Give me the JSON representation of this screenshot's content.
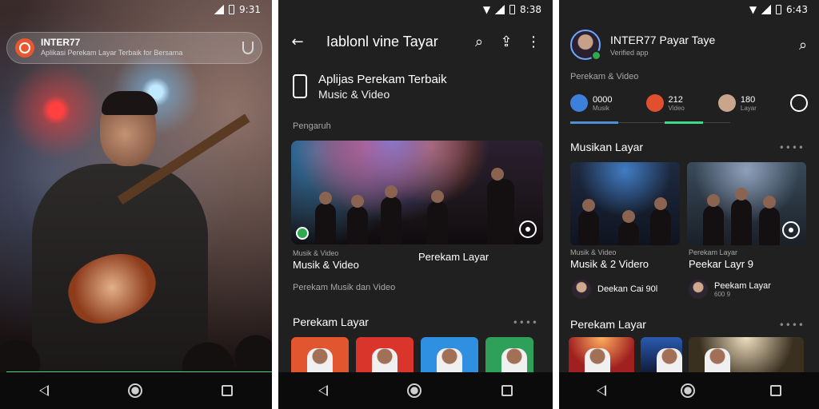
{
  "screens": {
    "player": {
      "status_time": "9:31",
      "search": {
        "title": "INTER77",
        "subtitle": "Aplikasi Perekam Layar Terbaik for Bersama"
      }
    },
    "app": {
      "status_time": "8:38",
      "toolbar_title": "Iablonl vine Tayar",
      "promo": {
        "title": "Aplijas Perekam Terbaik",
        "subtitle": "Music & Video"
      },
      "featured_label": "Pengaruh",
      "captions": [
        {
          "small": "Musik & Video",
          "title": "Musik & Video"
        },
        {
          "small": "",
          "title": "Perekam Layar"
        }
      ],
      "meta_line": "Perekam Musik dan Video",
      "section2_title": "Perekam Layar",
      "more_dots": "••••",
      "thumb_colors": [
        "#e2562f",
        "#d9352b",
        "#2f8fe0",
        "#2fa05a"
      ]
    },
    "profile": {
      "status_time": "6:43",
      "title": "INTER77 Payar Taye",
      "subtitle": "Verified app",
      "tagline": "Perekam & Video",
      "stats": [
        {
          "num": "0000",
          "sub": "Musik",
          "icon": "music-note-icon",
          "color": "#3d7fd9"
        },
        {
          "num": "212",
          "sub": "Video",
          "icon": "video-icon",
          "color": "#e0502f"
        },
        {
          "num": "180",
          "sub": "Layar",
          "icon": "artist-icon",
          "color": "#c9a58c"
        }
      ],
      "section1_title": "Musikan Layar",
      "cards": [
        {
          "small": "Musik & Video",
          "title": "Musik & 2 Videro"
        },
        {
          "small": "Perekam Layar",
          "title": "Peekar Layr 9"
        }
      ],
      "artists": [
        {
          "name": "Deekan Cai 90l",
          "sub": ""
        },
        {
          "name": "Peekam Layar",
          "sub": "600 9"
        }
      ],
      "section2_title": "Perekam Layar",
      "more_dots": "••••"
    }
  }
}
